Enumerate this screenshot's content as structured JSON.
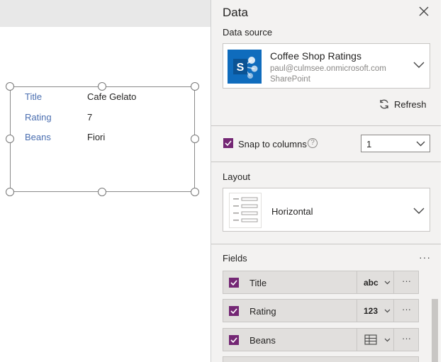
{
  "form": {
    "rows": [
      {
        "label": "Title",
        "value": "Cafe Gelato"
      },
      {
        "label": "Rating",
        "value": "7"
      },
      {
        "label": "Beans",
        "value": "Fiori"
      }
    ]
  },
  "panel": {
    "title": "Data",
    "data_source": {
      "section_label": "Data source",
      "name": "Coffee Shop Ratings",
      "account": "paul@culmsee.onmicrosoft.com",
      "type": "SharePoint",
      "logo_letter": "S",
      "refresh_label": "Refresh"
    },
    "snap": {
      "label": "Snap to columns",
      "checked": true,
      "help": "?",
      "value": "1"
    },
    "layout": {
      "section_label": "Layout",
      "value": "Horizontal"
    },
    "fields": {
      "section_label": "Fields",
      "more": "···",
      "items": [
        {
          "name": "Title",
          "type_label": "abc",
          "more": "···"
        },
        {
          "name": "Rating",
          "type_label": "123",
          "more": "···"
        },
        {
          "name": "Beans",
          "type_icon": "table-icon",
          "more": "···"
        }
      ]
    },
    "colors": {
      "accent": "#742774",
      "sharepoint": "#0f6cbd"
    }
  }
}
